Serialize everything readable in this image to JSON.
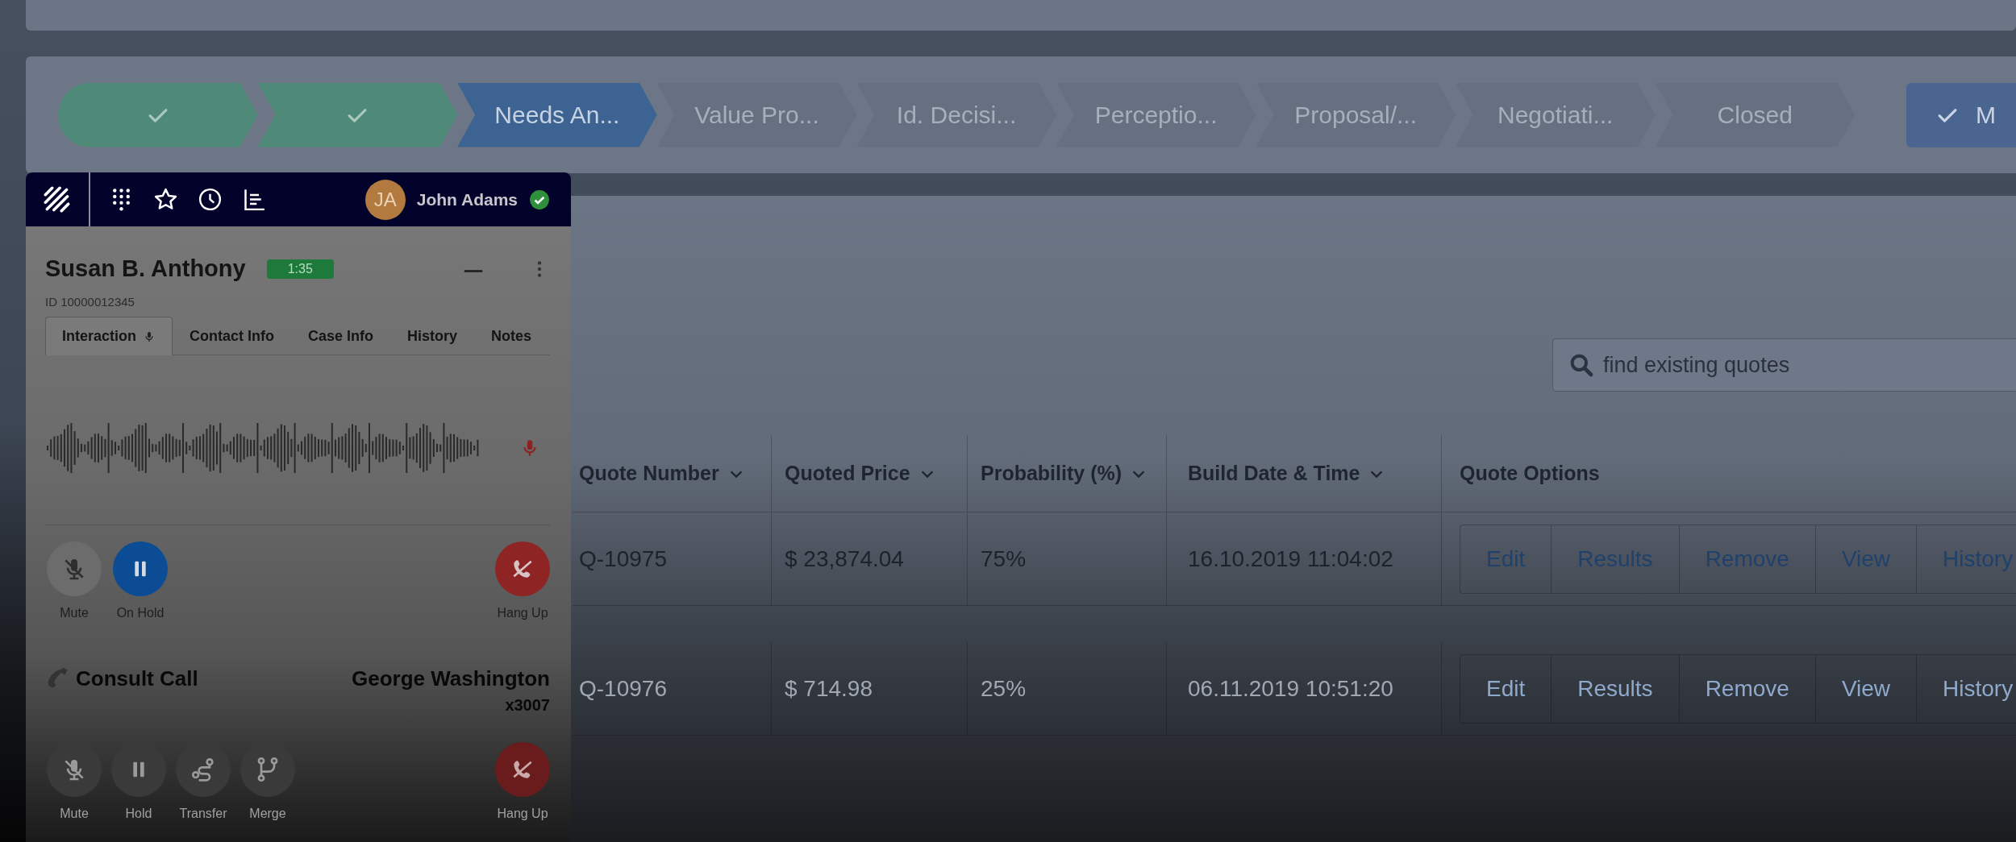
{
  "path": {
    "steps": [
      {
        "kind": "complete"
      },
      {
        "kind": "complete"
      },
      {
        "kind": "current",
        "label": "Needs An..."
      },
      {
        "kind": "upcoming",
        "label": "Value Pro..."
      },
      {
        "kind": "upcoming",
        "label": "Id. Decisi..."
      },
      {
        "kind": "upcoming",
        "label": "Perceptio..."
      },
      {
        "kind": "upcoming",
        "label": "Proposal/..."
      },
      {
        "kind": "upcoming",
        "label": "Negotiati..."
      },
      {
        "kind": "upcoming",
        "label": "Closed"
      }
    ],
    "button": {
      "label": "M"
    }
  },
  "phone": {
    "user": {
      "initials": "JA",
      "name": "John Adams",
      "online": true
    },
    "caller": {
      "name": "Susan B. Anthony",
      "timer": "1:35",
      "id": "ID 10000012345"
    },
    "tabs": [
      {
        "label": "Interaction",
        "selected": true,
        "mic": true
      },
      {
        "label": "Contact Info",
        "selected": false,
        "mic": false
      },
      {
        "label": "Case Info",
        "selected": false,
        "mic": false
      },
      {
        "label": "History",
        "selected": false,
        "mic": false
      },
      {
        "label": "Notes",
        "selected": false,
        "mic": false
      }
    ],
    "controls": [
      {
        "kind": "mute",
        "label": "Mute",
        "on": false
      },
      {
        "kind": "hold",
        "label": "On Hold",
        "on": true
      },
      {
        "kind": "hangup",
        "label": "Hang Up",
        "on": false
      }
    ],
    "consult": {
      "title": "Consult Call",
      "name": "George Washington",
      "extension": "x3007",
      "controls": [
        {
          "kind": "mute",
          "label": "Mute",
          "on": false
        },
        {
          "kind": "hold",
          "label": "Hold",
          "on": false
        },
        {
          "kind": "transfer",
          "label": "Transfer",
          "on": false
        },
        {
          "kind": "merge",
          "label": "Merge",
          "on": false
        },
        {
          "kind": "hangup",
          "label": "Hang Up",
          "on": false
        }
      ]
    }
  },
  "search": {
    "placeholder": "find existing quotes"
  },
  "table": {
    "columns": [
      {
        "label": "Quote Number",
        "sortable": true
      },
      {
        "label": "Quoted Price",
        "sortable": true
      },
      {
        "label": "Probability (%)",
        "sortable": true
      },
      {
        "label": "Build Date & Time",
        "sortable": true
      },
      {
        "label": "Quote Options",
        "sortable": false
      }
    ],
    "rows": [
      {
        "cells": [
          "Q-10975",
          "$ 23,874.04",
          "75%",
          "16.10.2019 11:04:02"
        ],
        "actions": [
          "Edit",
          "Results",
          "Remove",
          "View",
          "History"
        ]
      },
      {
        "cells": [
          "Q-10976",
          "$ 714.98",
          "25%",
          "06.11.2019 10:51:20"
        ],
        "actions": [
          "Edit",
          "Results",
          "Remove",
          "View",
          "History"
        ]
      }
    ]
  }
}
